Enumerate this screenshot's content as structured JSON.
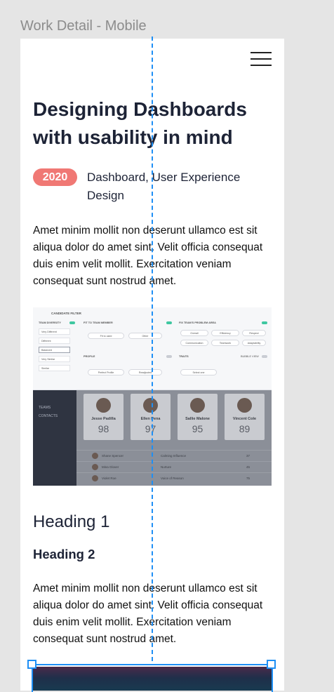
{
  "frame": {
    "label": "Work Detail - Mobile"
  },
  "header": {
    "menu_icon": "hamburger-icon"
  },
  "article": {
    "title": "Designing Dashboards with usability in mind",
    "year": "2020",
    "tags": "Dashboard, User Experience Design",
    "paragraph1": "Amet minim mollit non deserunt ullamco est sit aliqua dolor do amet sint. Velit officia consequat duis enim velit mollit. Exercitation veniam consequat sunt nostrud amet.",
    "heading1": "Heading 1",
    "heading2": "Heading 2",
    "paragraph2": "Amet minim mollit non deserunt ullamco est sit aliqua dolor do amet sint. Velit officia consequat duis enim velit mollit. Exercitation veniam consequat sunt nostrud amet."
  },
  "dashboard": {
    "filter_title": "CANDIDATE FILTER",
    "team_diversity": "TEAM DIVERSITY",
    "fit_team_member": "FIT TO TEAM MEMBER",
    "fit_problem_area": "FIX TEAM'S PROBLEM AREA",
    "profile": "PROFILE",
    "traits": "TRAITS",
    "bubble_view": "BUBBLE VIEW",
    "diversity_options": [
      "Very Different",
      "Different",
      "Balanced",
      "Very Similar",
      "Similar"
    ],
    "fit_options": [
      "Fit to used",
      "Other"
    ],
    "problem_pills": [
      "Overall",
      "Efficiency",
      "Respect",
      "Communication",
      "Teamwork",
      "Adaptability"
    ],
    "profile_options": [
      "Perfect Profile",
      "Readjusted"
    ],
    "select_one": "Select one",
    "nav": [
      "TEAMS",
      "CONTACTS"
    ],
    "candidates": [
      {
        "name": "Jesse Padilla",
        "score": "98"
      },
      {
        "name": "Ellen Pena",
        "score": "97"
      },
      {
        "name": "Sallie Malone",
        "score": "95"
      },
      {
        "name": "Vincent Cole",
        "score": "89"
      }
    ],
    "list": [
      {
        "name": "Shane Spencer",
        "desc": "Calming Influence",
        "value": "37"
      },
      {
        "name": "Mina Glover",
        "desc": "Nurture",
        "value": "45"
      },
      {
        "name": "Violet Roe",
        "desc": "Voice of Reason",
        "value": "75"
      }
    ]
  },
  "colors": {
    "accent": "#f07874",
    "selection": "#1e8ff5",
    "title": "#1d2336"
  }
}
